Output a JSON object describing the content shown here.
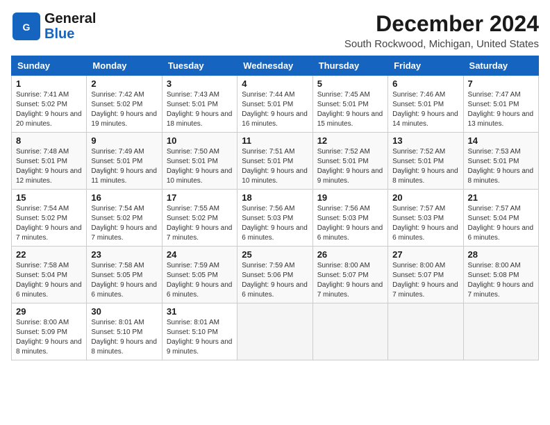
{
  "header": {
    "logo_line1": "General",
    "logo_line2": "Blue",
    "month_title": "December 2024",
    "location": "South Rockwood, Michigan, United States"
  },
  "weekdays": [
    "Sunday",
    "Monday",
    "Tuesday",
    "Wednesday",
    "Thursday",
    "Friday",
    "Saturday"
  ],
  "weeks": [
    [
      {
        "day": "1",
        "sunrise": "7:41 AM",
        "sunset": "5:02 PM",
        "daylight": "9 hours and 20 minutes."
      },
      {
        "day": "2",
        "sunrise": "7:42 AM",
        "sunset": "5:02 PM",
        "daylight": "9 hours and 19 minutes."
      },
      {
        "day": "3",
        "sunrise": "7:43 AM",
        "sunset": "5:01 PM",
        "daylight": "9 hours and 18 minutes."
      },
      {
        "day": "4",
        "sunrise": "7:44 AM",
        "sunset": "5:01 PM",
        "daylight": "9 hours and 16 minutes."
      },
      {
        "day": "5",
        "sunrise": "7:45 AM",
        "sunset": "5:01 PM",
        "daylight": "9 hours and 15 minutes."
      },
      {
        "day": "6",
        "sunrise": "7:46 AM",
        "sunset": "5:01 PM",
        "daylight": "9 hours and 14 minutes."
      },
      {
        "day": "7",
        "sunrise": "7:47 AM",
        "sunset": "5:01 PM",
        "daylight": "9 hours and 13 minutes."
      }
    ],
    [
      {
        "day": "8",
        "sunrise": "7:48 AM",
        "sunset": "5:01 PM",
        "daylight": "9 hours and 12 minutes."
      },
      {
        "day": "9",
        "sunrise": "7:49 AM",
        "sunset": "5:01 PM",
        "daylight": "9 hours and 11 minutes."
      },
      {
        "day": "10",
        "sunrise": "7:50 AM",
        "sunset": "5:01 PM",
        "daylight": "9 hours and 10 minutes."
      },
      {
        "day": "11",
        "sunrise": "7:51 AM",
        "sunset": "5:01 PM",
        "daylight": "9 hours and 10 minutes."
      },
      {
        "day": "12",
        "sunrise": "7:52 AM",
        "sunset": "5:01 PM",
        "daylight": "9 hours and 9 minutes."
      },
      {
        "day": "13",
        "sunrise": "7:52 AM",
        "sunset": "5:01 PM",
        "daylight": "9 hours and 8 minutes."
      },
      {
        "day": "14",
        "sunrise": "7:53 AM",
        "sunset": "5:01 PM",
        "daylight": "9 hours and 8 minutes."
      }
    ],
    [
      {
        "day": "15",
        "sunrise": "7:54 AM",
        "sunset": "5:02 PM",
        "daylight": "9 hours and 7 minutes."
      },
      {
        "day": "16",
        "sunrise": "7:54 AM",
        "sunset": "5:02 PM",
        "daylight": "9 hours and 7 minutes."
      },
      {
        "day": "17",
        "sunrise": "7:55 AM",
        "sunset": "5:02 PM",
        "daylight": "9 hours and 7 minutes."
      },
      {
        "day": "18",
        "sunrise": "7:56 AM",
        "sunset": "5:03 PM",
        "daylight": "9 hours and 6 minutes."
      },
      {
        "day": "19",
        "sunrise": "7:56 AM",
        "sunset": "5:03 PM",
        "daylight": "9 hours and 6 minutes."
      },
      {
        "day": "20",
        "sunrise": "7:57 AM",
        "sunset": "5:03 PM",
        "daylight": "9 hours and 6 minutes."
      },
      {
        "day": "21",
        "sunrise": "7:57 AM",
        "sunset": "5:04 PM",
        "daylight": "9 hours and 6 minutes."
      }
    ],
    [
      {
        "day": "22",
        "sunrise": "7:58 AM",
        "sunset": "5:04 PM",
        "daylight": "9 hours and 6 minutes."
      },
      {
        "day": "23",
        "sunrise": "7:58 AM",
        "sunset": "5:05 PM",
        "daylight": "9 hours and 6 minutes."
      },
      {
        "day": "24",
        "sunrise": "7:59 AM",
        "sunset": "5:05 PM",
        "daylight": "9 hours and 6 minutes."
      },
      {
        "day": "25",
        "sunrise": "7:59 AM",
        "sunset": "5:06 PM",
        "daylight": "9 hours and 6 minutes."
      },
      {
        "day": "26",
        "sunrise": "8:00 AM",
        "sunset": "5:07 PM",
        "daylight": "9 hours and 7 minutes."
      },
      {
        "day": "27",
        "sunrise": "8:00 AM",
        "sunset": "5:07 PM",
        "daylight": "9 hours and 7 minutes."
      },
      {
        "day": "28",
        "sunrise": "8:00 AM",
        "sunset": "5:08 PM",
        "daylight": "9 hours and 7 minutes."
      }
    ],
    [
      {
        "day": "29",
        "sunrise": "8:00 AM",
        "sunset": "5:09 PM",
        "daylight": "9 hours and 8 minutes."
      },
      {
        "day": "30",
        "sunrise": "8:01 AM",
        "sunset": "5:10 PM",
        "daylight": "9 hours and 8 minutes."
      },
      {
        "day": "31",
        "sunrise": "8:01 AM",
        "sunset": "5:10 PM",
        "daylight": "9 hours and 9 minutes."
      },
      null,
      null,
      null,
      null
    ]
  ]
}
